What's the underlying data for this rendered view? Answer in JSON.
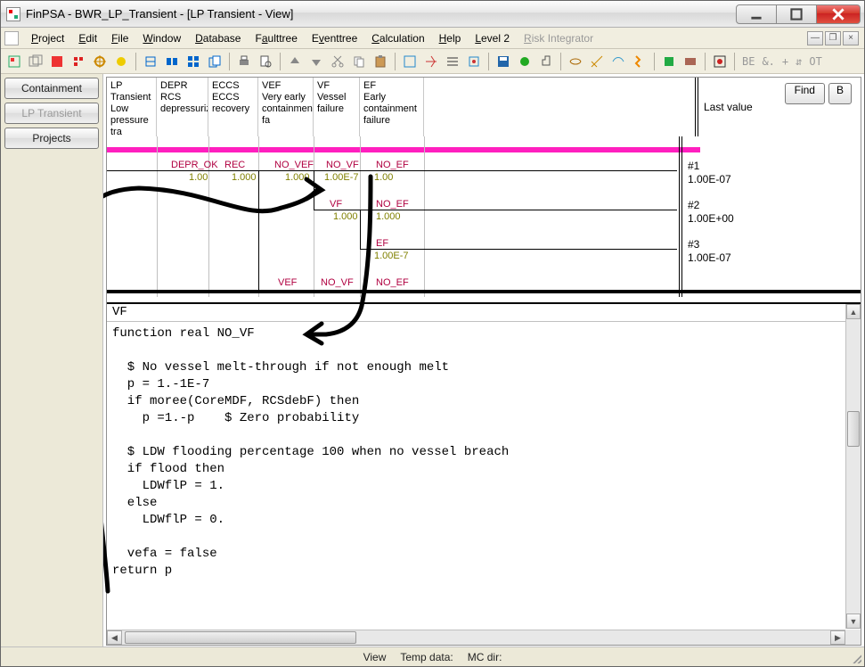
{
  "window": {
    "title": "FinPSA - BWR_LP_Transient - [LP Transient  - View]"
  },
  "menu": {
    "items": [
      "Project",
      "Edit",
      "File",
      "Window",
      "Database",
      "Faulttree",
      "Eventtree",
      "Calculation",
      "Help",
      "Level 2",
      "Risk Integrator"
    ],
    "disabled_index": 10
  },
  "left_tabs": {
    "containment": "Containment",
    "lp_transient": "LP Transient",
    "projects": "Projects"
  },
  "find": {
    "find": "Find",
    "b": "B"
  },
  "tree": {
    "columns": [
      {
        "code": "LP Transient",
        "desc": "Low pressure tra"
      },
      {
        "code": "DEPR",
        "desc": "RCS depressurization"
      },
      {
        "code": "ECCS",
        "desc": "ECCS recovery"
      },
      {
        "code": "VEF",
        "desc": "Very early containment fa"
      },
      {
        "code": "VF",
        "desc": "Vessel failure"
      },
      {
        "code": "EF",
        "desc": "Early containment failure"
      }
    ],
    "right_header": "Last value",
    "branch_labels": {
      "depr_ok": "DEPR_OK",
      "rec": "REC",
      "no_vef": "NO_VEF",
      "vef": "VEF",
      "no_vf": "NO_VF",
      "vf": "VF",
      "no_ef": "NO_EF",
      "ef": "EF",
      "v_1_00": "1.00",
      "v_1_000": "1.000",
      "v_1_00e7": "1.00E-7"
    },
    "sequences": [
      {
        "id": "#1",
        "val": "1.00E-07"
      },
      {
        "id": "#2",
        "val": "1.00E+00"
      },
      {
        "id": "#3",
        "val": "1.00E-07"
      }
    ]
  },
  "code": {
    "tab_label": "VF",
    "text": "function real NO_VF\n\n  $ No vessel melt-through if not enough melt\n  p = 1.-1E-7\n  if moree(CoreMDF, RCSdebF) then\n    p =1.-p    $ Zero probability\n\n  $ LDW flooding percentage 100 when no vessel breach\n  if flood then\n    LDWflP = 1.\n  else\n    LDWflP = 0.\n\n  vefa = false\nreturn p"
  },
  "status": {
    "view": "View",
    "temp_data": "Temp data:",
    "mc_dir": "MC dir:"
  },
  "toolbar_text": {
    "be": "BE",
    "amp": "&.",
    "plus": "+",
    "arrow": "⇵",
    "ot": "OT"
  }
}
